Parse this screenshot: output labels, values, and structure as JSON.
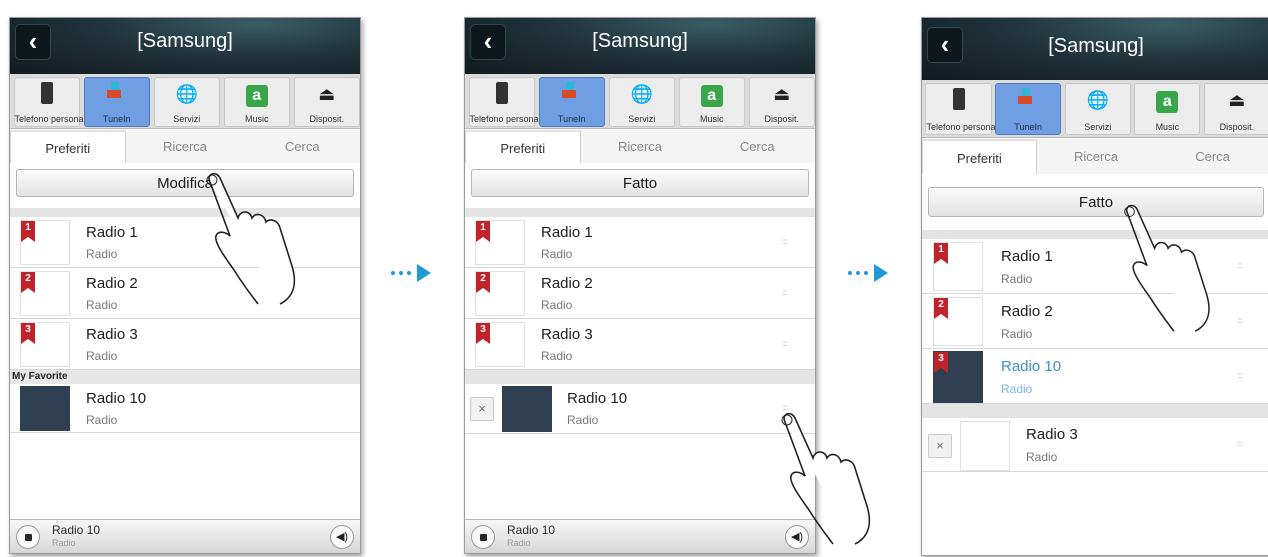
{
  "colors": {
    "accent_blue": "#3a8fd6",
    "badge_red": "#c0242a",
    "selected_tab_blue": "#6f9ee3",
    "header_dark": "#20343b"
  },
  "screens": [
    {
      "title": "[Samsung]",
      "categories": [
        {
          "label": "Telefono personale",
          "icon": "phone-icon"
        },
        {
          "label": "TuneIn",
          "icon": "tunein-icon"
        },
        {
          "label": "Servizi",
          "icon": "globe-icon"
        },
        {
          "label": "Music",
          "icon": "amazon-icon"
        },
        {
          "label": "Disposit.",
          "icon": "device-icon"
        }
      ],
      "tabs": [
        "Preferiti",
        "Ricerca",
        "Cerca"
      ],
      "action_label": "Modifica",
      "items": [
        {
          "badge": "1",
          "name": "Radio 1",
          "sub": "Radio"
        },
        {
          "badge": "2",
          "name": "Radio 2",
          "sub": "Radio"
        },
        {
          "badge": "3",
          "name": "Radio 3",
          "sub": "Radio"
        }
      ],
      "group_label": "My Favorite",
      "group_items": [
        {
          "name": "Radio 10",
          "sub": "Radio"
        }
      ],
      "player": {
        "name": "Radio 10",
        "sub": "Radio"
      }
    },
    {
      "title": "[Samsung]",
      "categories": [
        {
          "label": "Telefono personale"
        },
        {
          "label": "TuneIn"
        },
        {
          "label": "Servizi"
        },
        {
          "label": "Music"
        },
        {
          "label": "Disposit."
        }
      ],
      "tabs": [
        "Preferiti",
        "Ricerca",
        "Cerca"
      ],
      "action_label": "Fatto",
      "items": [
        {
          "badge": "1",
          "name": "Radio 1",
          "sub": "Radio"
        },
        {
          "badge": "2",
          "name": "Radio 2",
          "sub": "Radio"
        },
        {
          "badge": "3",
          "name": "Radio 3",
          "sub": "Radio"
        }
      ],
      "group_items": [
        {
          "name": "Radio 10",
          "sub": "Radio",
          "delete": "×"
        }
      ],
      "player": {
        "name": "Radio 10",
        "sub": "Radio"
      }
    },
    {
      "title": "[Samsung]",
      "categories": [
        {
          "label": "Telefono personale"
        },
        {
          "label": "TuneIn"
        },
        {
          "label": "Servizi"
        },
        {
          "label": "Music"
        },
        {
          "label": "Disposit."
        }
      ],
      "tabs": [
        "Preferiti",
        "Ricerca",
        "Cerca"
      ],
      "action_label": "Fatto",
      "items": [
        {
          "badge": "1",
          "name": "Radio 1",
          "sub": "Radio"
        },
        {
          "badge": "2",
          "name": "Radio 2",
          "sub": "Radio"
        },
        {
          "badge": "3",
          "name": "Radio 10",
          "sub": "Radio",
          "highlight": true
        }
      ],
      "group_items": [
        {
          "name": "Radio 3",
          "sub": "Radio",
          "delete": "×"
        }
      ]
    }
  ],
  "glyphs": {
    "back": "‹",
    "globe": "🌐",
    "amazon": "a",
    "device": "⏏",
    "grip": "::::",
    "volume": "◀)",
    "arrow_dots": "•••"
  }
}
